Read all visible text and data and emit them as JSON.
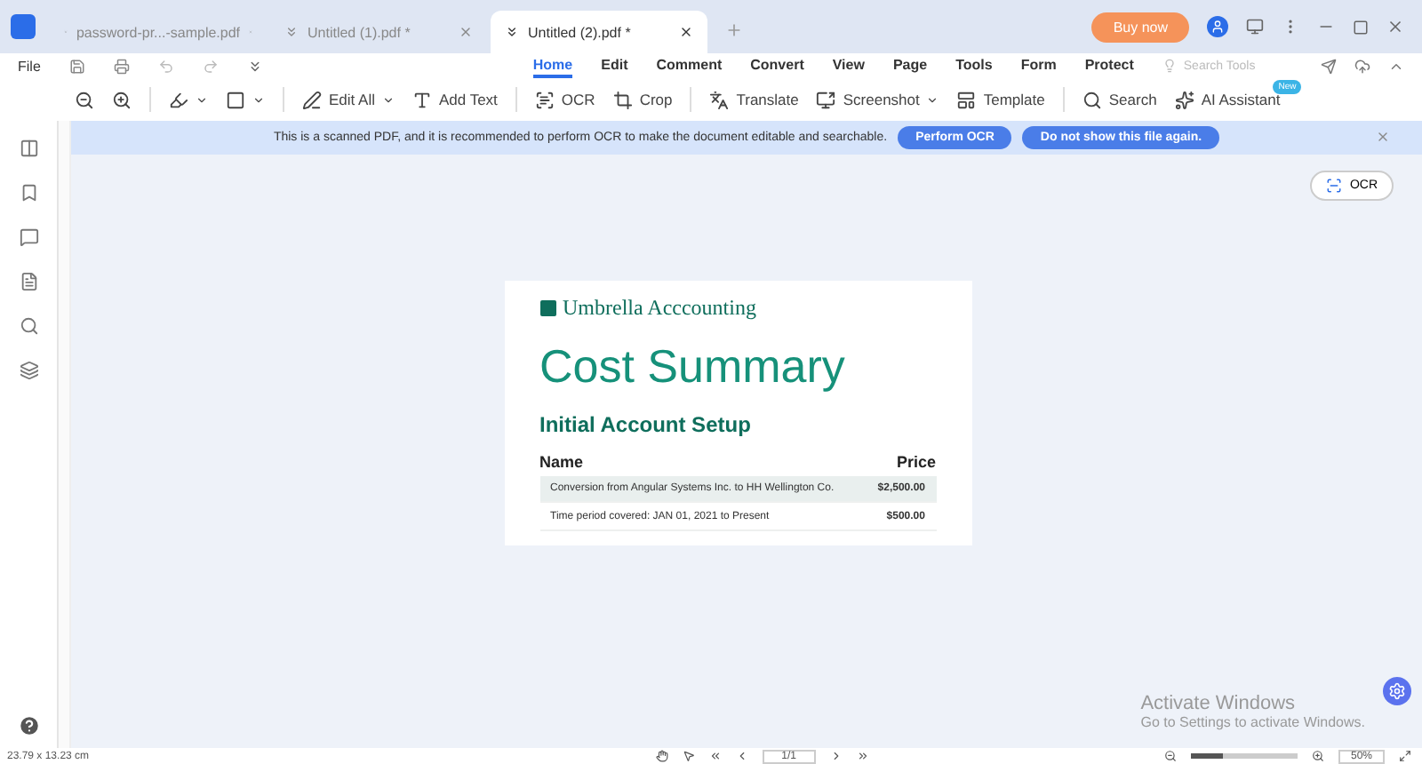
{
  "tabs": [
    {
      "label": "password-pr...-sample.pdf",
      "selected": false
    },
    {
      "label": "Untitled (1).pdf *",
      "selected": false
    },
    {
      "label": "Untitled (2).pdf *",
      "selected": true
    }
  ],
  "title_bar": {
    "buy_button": "Buy now"
  },
  "menu": {
    "file": "File",
    "items": [
      {
        "label": "Home",
        "selected": true
      },
      {
        "label": "Edit",
        "selected": false
      },
      {
        "label": "Comment",
        "selected": false
      },
      {
        "label": "Convert",
        "selected": false
      },
      {
        "label": "View",
        "selected": false
      },
      {
        "label": "Page",
        "selected": false
      },
      {
        "label": "Tools",
        "selected": false
      },
      {
        "label": "Form",
        "selected": false
      },
      {
        "label": "Protect",
        "selected": false
      }
    ],
    "search_placeholder": "Search Tools"
  },
  "toolbar": [
    {
      "kind": "icon"
    },
    {
      "kind": "icon"
    },
    {
      "kind": "sep"
    },
    {
      "kind": "icon",
      "dropdown": true
    },
    {
      "kind": "icon",
      "dropdown": true
    },
    {
      "kind": "sep"
    },
    {
      "kind": "text",
      "label": "Edit All",
      "dropdown": true
    },
    {
      "kind": "text",
      "label": "Add Text",
      "dropdown": false
    },
    {
      "kind": "sep"
    },
    {
      "kind": "text",
      "label": "OCR",
      "dropdown": false
    },
    {
      "kind": "text",
      "label": "Crop",
      "dropdown": false
    },
    {
      "kind": "sep"
    },
    {
      "kind": "text",
      "label": "Translate",
      "dropdown": false
    },
    {
      "kind": "text",
      "label": "Screenshot",
      "dropdown": true
    },
    {
      "kind": "text",
      "label": "Template",
      "dropdown": false
    },
    {
      "kind": "sep"
    },
    {
      "kind": "text",
      "label": "Search",
      "dropdown": false
    },
    {
      "kind": "text",
      "label": "AI Assistant",
      "dropdown": false,
      "badge": "New"
    }
  ],
  "banner": {
    "message": "This is a scanned PDF, and it is recommended to perform OCR to make the document editable and searchable.",
    "buttons": [
      "Perform OCR",
      "Do not show this file again."
    ]
  },
  "ocr_button": "OCR",
  "document": {
    "brand": "Umbrella Acccounting",
    "title": "Cost Summary",
    "section": "Initial Account Setup",
    "columns": [
      "Name",
      "Price"
    ],
    "rows": [
      {
        "name": "Conversion from Angular Systems Inc. to HH Wellington Co.",
        "price": "$2,500.00",
        "shaded": true
      },
      {
        "name": "Time period covered: JAN 01, 2021 to Present",
        "price": "$500.00",
        "shaded": false
      }
    ]
  },
  "activation": {
    "title": "Activate Windows",
    "subtitle": "Go to Settings to activate Windows."
  },
  "status_bar": {
    "size": "23.79 x 13.23 cm",
    "page": "1/1",
    "zoom_slider": {
      "level": 0.3
    },
    "zoom": "50%"
  }
}
